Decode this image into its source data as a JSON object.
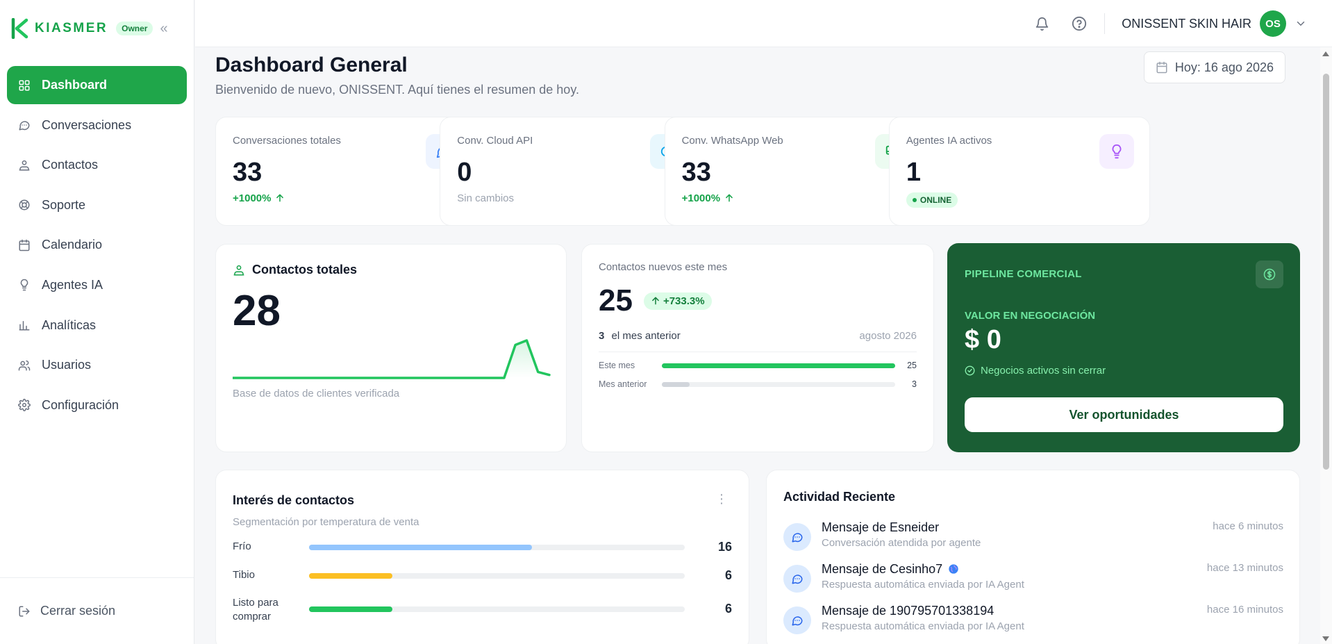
{
  "brand": {
    "name": "KIASMER",
    "badge": "Owner"
  },
  "sidebar": {
    "items": [
      {
        "label": "Dashboard",
        "icon": "grid-icon"
      },
      {
        "label": "Conversaciones",
        "icon": "chat-icon"
      },
      {
        "label": "Contactos",
        "icon": "contacts-icon"
      },
      {
        "label": "Soporte",
        "icon": "lifebuoy-icon"
      },
      {
        "label": "Calendario",
        "icon": "calendar-icon"
      },
      {
        "label": "Agentes IA",
        "icon": "bulb-icon"
      },
      {
        "label": "Analíticas",
        "icon": "bar-chart-icon"
      },
      {
        "label": "Usuarios",
        "icon": "users-icon"
      },
      {
        "label": "Configuración",
        "icon": "gear-icon"
      }
    ],
    "logout": "Cerrar sesión"
  },
  "topbar": {
    "user_name": "ONISSENT SKIN HAIR",
    "avatar_initials": "OS"
  },
  "header": {
    "title": "Dashboard General",
    "subtitle": "Bienvenido de nuevo, ONISSENT. Aquí tienes el resumen de hoy.",
    "date": "Hoy: 16 ago 2026"
  },
  "stats": [
    {
      "label": "Conversaciones totales",
      "value": "33",
      "footer": "+1000%",
      "trend": "up",
      "icon": "chat-icon",
      "icon_bg": "#eef4ff",
      "icon_color": "#3b82f6"
    },
    {
      "label": "Conv. Cloud API",
      "value": "0",
      "footer": "Sin cambios",
      "trend": "none",
      "icon": "cloud-icon",
      "icon_bg": "#e8f7fd",
      "icon_color": "#0ea5e9"
    },
    {
      "label": "Conv. WhatsApp Web",
      "value": "33",
      "footer": "+1000%",
      "trend": "up",
      "icon": "monitor-icon",
      "icon_bg": "#ecfbf1",
      "icon_color": "#16a34a"
    },
    {
      "label": "Agentes IA activos",
      "value": "1",
      "footer": "ONLINE",
      "trend": "online",
      "icon": "bulb-icon",
      "icon_bg": "#f6efff",
      "icon_color": "#a855f7"
    }
  ],
  "contacts_total": {
    "title": "Contactos totales",
    "value": "28",
    "caption": "Base de datos de clientes verificada",
    "sparkline": [
      0,
      0,
      0,
      0,
      0,
      0,
      0,
      0,
      0,
      0,
      0,
      0,
      0,
      0,
      0,
      0,
      0,
      0,
      0,
      0,
      0,
      0,
      0,
      0,
      0,
      22,
      25,
      4,
      2
    ]
  },
  "contacts_new": {
    "title": "Contactos nuevos este mes",
    "value": "25",
    "change": "+733.3%",
    "prev_value": "3",
    "prev_label": "el mes anterior",
    "period": "agosto 2026",
    "bars": [
      {
        "label": "Este mes",
        "value": 25,
        "color": "#22c55e"
      },
      {
        "label": "Mes anterior",
        "value": 3,
        "color": "#d1d5db"
      }
    ],
    "bar_max": 25
  },
  "pipeline": {
    "title": "PIPELINE COMERCIAL",
    "sub": "VALOR EN NEGOCIACIÓN",
    "value": "$ 0",
    "status": "Negocios activos sin cerrar",
    "button": "Ver oportunidades"
  },
  "interest": {
    "title": "Interés de contactos",
    "subtitle": "Segmentación por temperatura de venta",
    "max": 27,
    "rows": [
      {
        "label": "Frío",
        "value": 16,
        "color": "#93c5fd"
      },
      {
        "label": "Tibio",
        "value": 6,
        "color": "#fbbf24"
      },
      {
        "label": "Listo para comprar",
        "value": 6,
        "color": "#22c55e"
      }
    ]
  },
  "activity": {
    "title": "Actividad Reciente",
    "items": [
      {
        "title": "Mensaje de Esneider",
        "sub": "Conversación atendida por agente",
        "time": "hace 6 minutos",
        "globe": false
      },
      {
        "title": "Mensaje de Cesinho7",
        "sub": "Respuesta automática enviada por IA Agent",
        "time": "hace 13 minutos",
        "globe": true
      },
      {
        "title": "Mensaje de 190795701338194",
        "sub": "Respuesta automática enviada por IA Agent",
        "time": "hace 16 minutos",
        "globe": false
      }
    ]
  }
}
